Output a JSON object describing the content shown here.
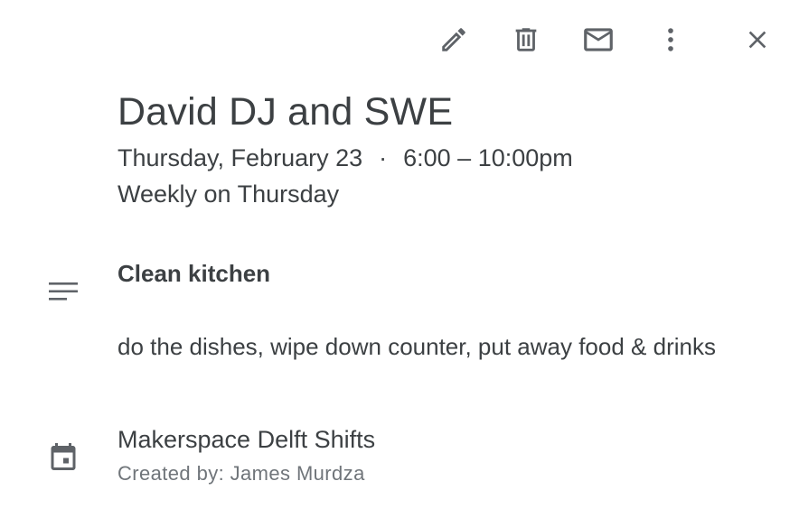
{
  "toolbar": {
    "edit_icon": "pencil-icon",
    "delete_icon": "trash-icon",
    "email_icon": "mail-icon",
    "more_icon": "more-vert-icon",
    "close_icon": "close-icon"
  },
  "event": {
    "title": "David DJ and SWE",
    "date": "Thursday, February 23",
    "separator": "·",
    "time": "6:00 – 10:00pm",
    "recurrence": "Weekly on Thursday"
  },
  "description": {
    "icon": "notes-icon",
    "heading": "Clean kitchen",
    "body": "do the dishes, wipe down counter, put away food & drinks"
  },
  "calendar": {
    "icon": "calendar-icon",
    "name": "Makerspace Delft Shifts",
    "created_by": "Created by: James Murdza"
  },
  "colors": {
    "text_primary": "#3c4043",
    "text_secondary": "#70757a",
    "icon": "#5f6368",
    "background": "#ffffff"
  }
}
